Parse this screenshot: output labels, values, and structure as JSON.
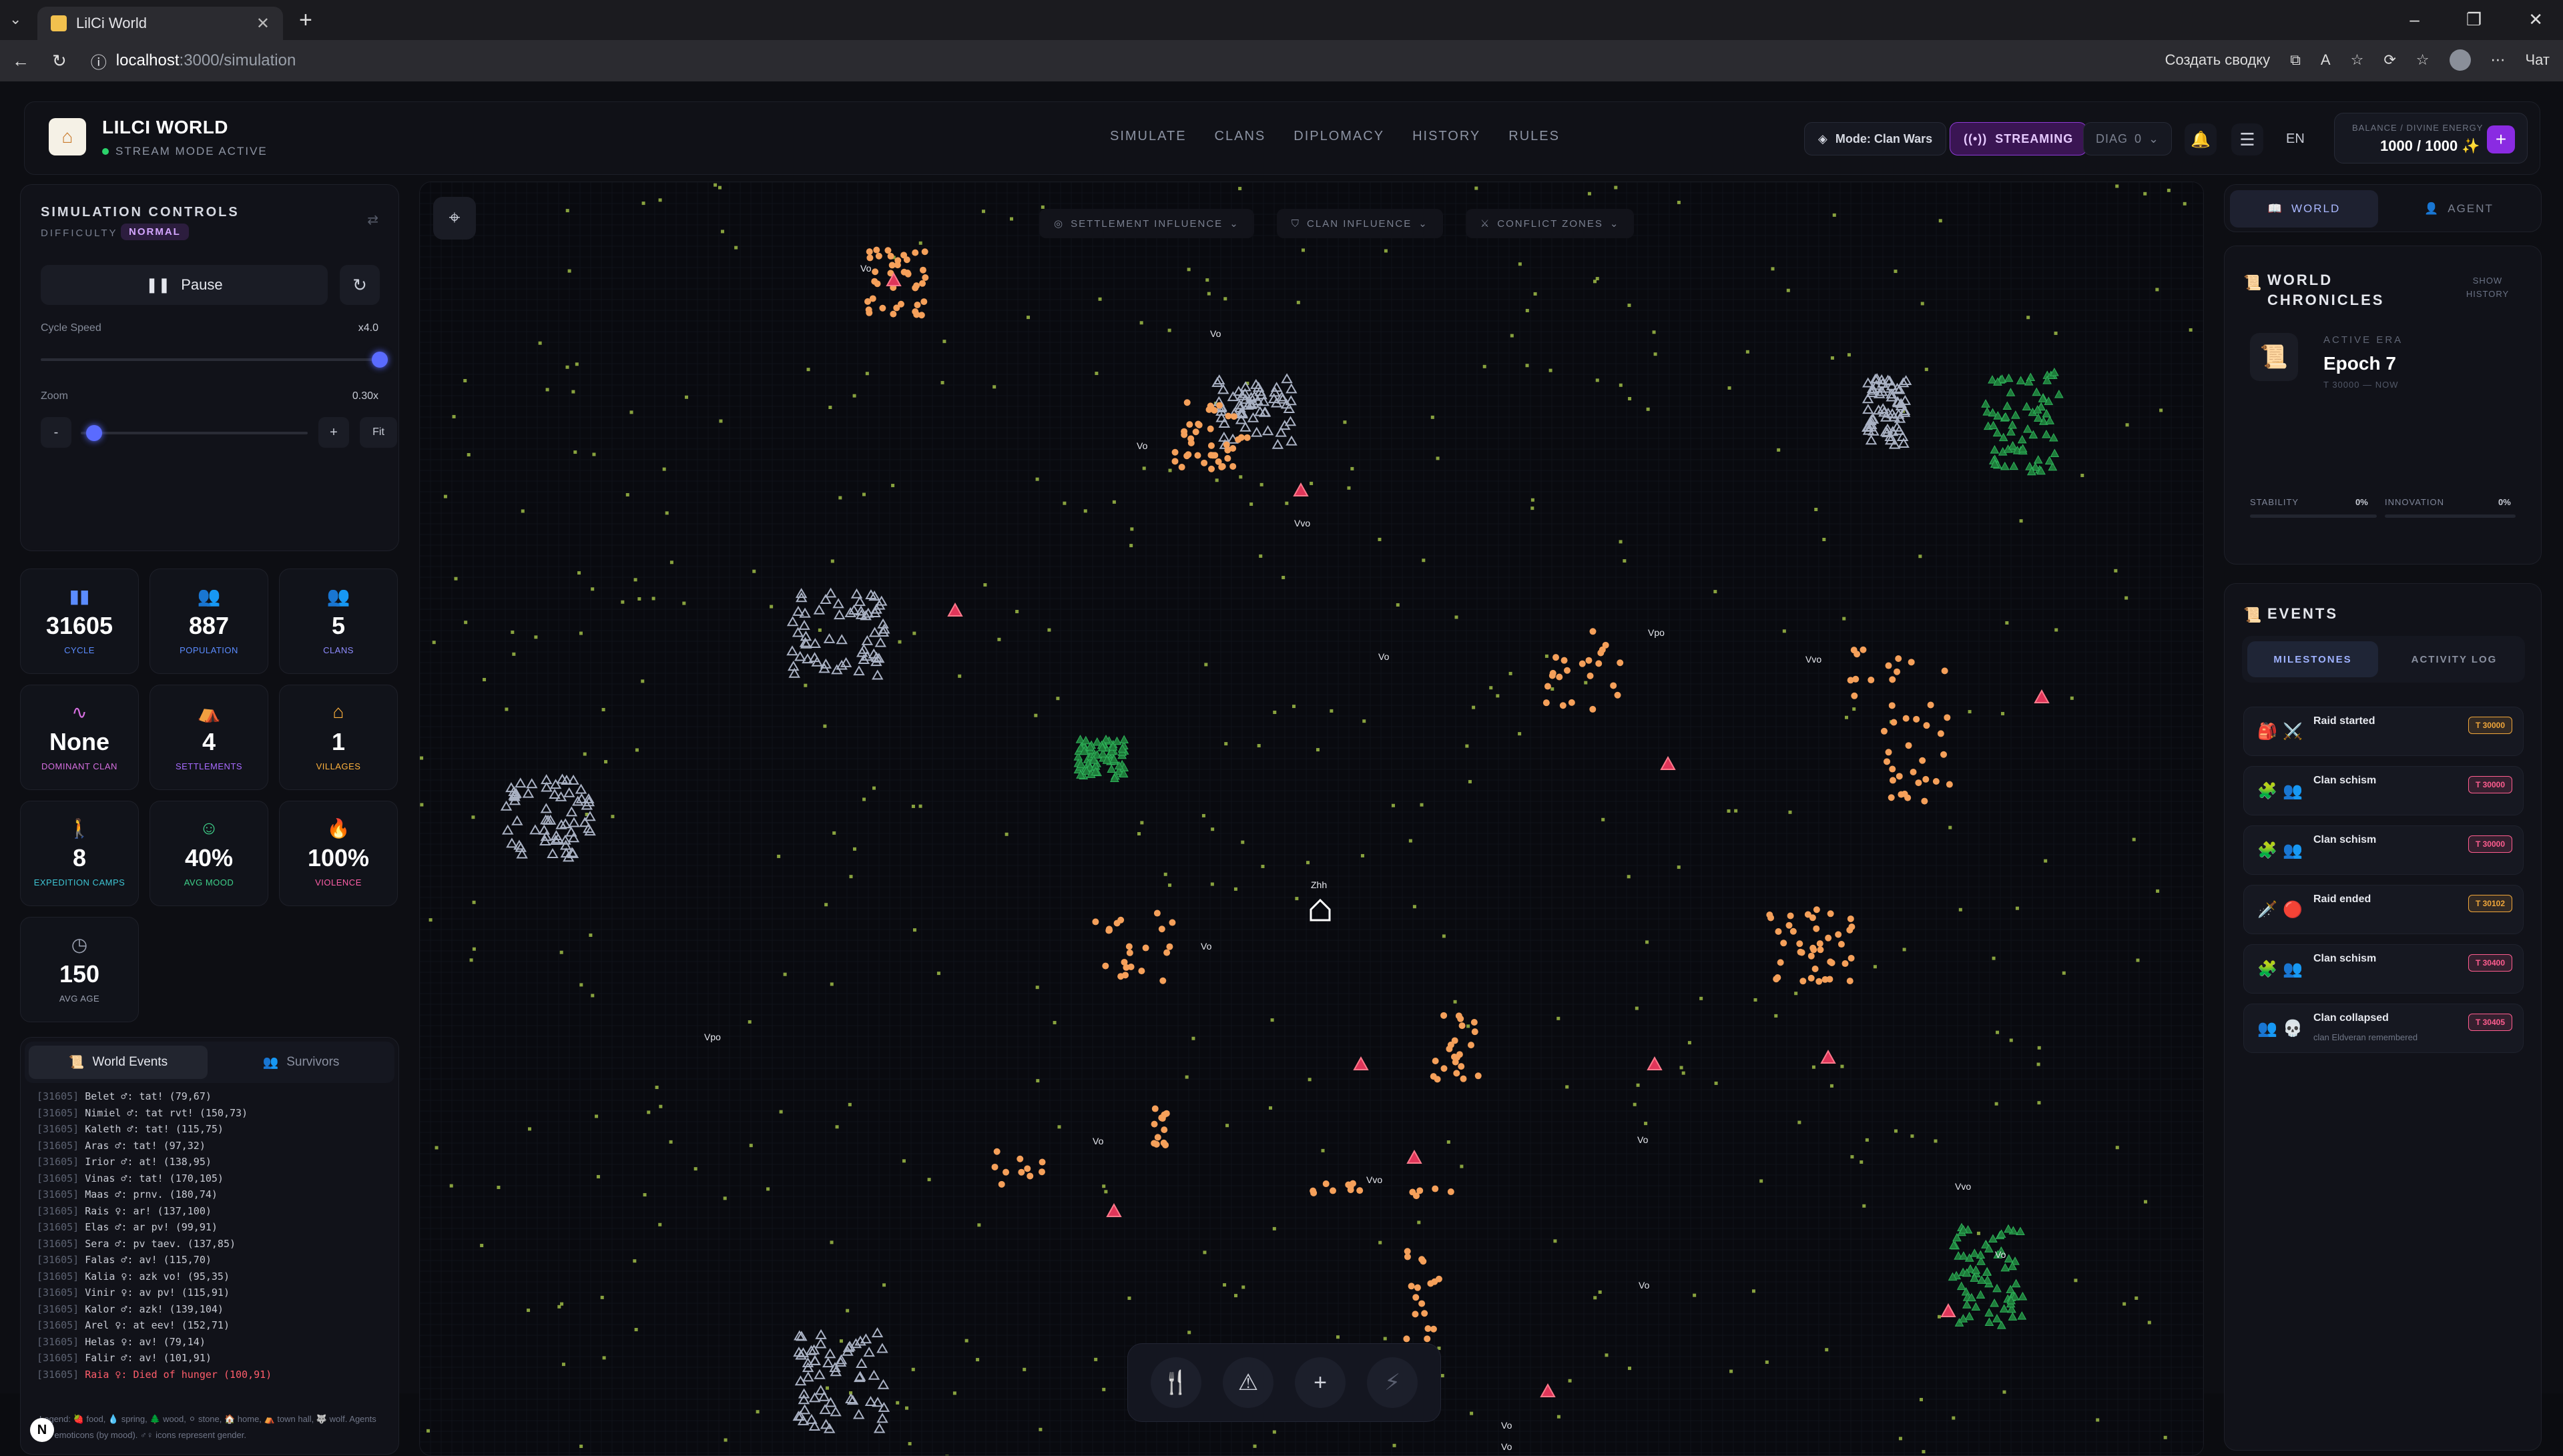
{
  "browser": {
    "tab_title": "LilCi World",
    "url_host": "localhost",
    "url_path": ":3000/simulation",
    "summary_label": "Создать сводку",
    "chat_label": "Чат"
  },
  "header": {
    "brand": "LILCI WORLD",
    "stream_status": "STREAM MODE ACTIVE",
    "nav": [
      "SIMULATE",
      "CLANS",
      "DIPLOMACY",
      "HISTORY",
      "RULES"
    ],
    "mode": "Mode: Clan Wars",
    "streaming": "STREAMING",
    "diag": "DIAG",
    "diag_count": "0",
    "lang": "EN",
    "balance_label": "BALANCE / DIVINE ENERGY",
    "balance_value": "1000 / 1000 ✨"
  },
  "sim": {
    "title": "SIMULATION CONTROLS",
    "difficulty_label": "DIFFICULTY",
    "difficulty_value": "NORMAL",
    "pause_label": "Pause",
    "cycle_speed_label": "Cycle Speed",
    "cycle_speed_value": "x4.0",
    "cycle_speed_level": 1.0,
    "zoom_label": "Zoom",
    "zoom_value": "0.30x",
    "zoom_level": 0.06,
    "zoom_minus": "-",
    "zoom_plus": "+",
    "fit_label": "Fit"
  },
  "stats": [
    {
      "value": "31605",
      "label": "CYCLE",
      "color": "#5b8cff",
      "icon": "bar-chart-icon"
    },
    {
      "value": "887",
      "label": "POPULATION",
      "color": "#5b8cff",
      "icon": "people-icon"
    },
    {
      "value": "5",
      "label": "CLANS",
      "color": "#8f8cff",
      "icon": "group-icon"
    },
    {
      "value": "None",
      "label": "DOMINANT CLAN",
      "color": "#d66fe0",
      "icon": "pulse-icon"
    },
    {
      "value": "4",
      "label": "SETTLEMENTS",
      "color": "#a86bff",
      "icon": "tent-icon"
    },
    {
      "value": "1",
      "label": "VILLAGES",
      "color": "#ffb23d",
      "icon": "house-icon"
    },
    {
      "value": "8",
      "label": "EXPEDITION CAMPS",
      "color": "#3ec5d4",
      "icon": "hiker-icon"
    },
    {
      "value": "40%",
      "label": "AVG MOOD",
      "color": "#3fd18a",
      "icon": "smile-icon"
    },
    {
      "value": "100%",
      "label": "VIOLENCE",
      "color": "#ff5fa8",
      "icon": "flame-icon"
    },
    {
      "value": "150",
      "label": "AVG AGE",
      "color": "#9aa0b0",
      "icon": "clock-icon"
    }
  ],
  "left_tabs": {
    "world_events": "World Events",
    "survivors": "Survivors"
  },
  "log": [
    {
      "stamp": "[31605]",
      "text": "Belet ♂: tat! (79,67)",
      "red": false
    },
    {
      "stamp": "[31605]",
      "text": "Nimiel ♂: tat rvt! (150,73)",
      "red": false
    },
    {
      "stamp": "[31605]",
      "text": "Kaleth ♂: tat! (115,75)",
      "red": false
    },
    {
      "stamp": "[31605]",
      "text": "Aras ♂: tat! (97,32)",
      "red": false
    },
    {
      "stamp": "[31605]",
      "text": "Irior ♂: at! (138,95)",
      "red": false
    },
    {
      "stamp": "[31605]",
      "text": "Vinas ♂: tat! (170,105)",
      "red": false
    },
    {
      "stamp": "[31605]",
      "text": "Maas ♂: prnv. (180,74)",
      "red": false
    },
    {
      "stamp": "[31605]",
      "text": "Rais ♀: ar! (137,100)",
      "red": false
    },
    {
      "stamp": "[31605]",
      "text": "Elas ♂: ar pv! (99,91)",
      "red": false
    },
    {
      "stamp": "[31605]",
      "text": "Sera ♂: pv taev. (137,85)",
      "red": false
    },
    {
      "stamp": "[31605]",
      "text": "Falas ♂: av! (115,70)",
      "red": false
    },
    {
      "stamp": "[31605]",
      "text": "Kalia ♀: azk vo! (95,35)",
      "red": false
    },
    {
      "stamp": "[31605]",
      "text": "Vinir ♀: av pv! (115,91)",
      "red": false
    },
    {
      "stamp": "[31605]",
      "text": "Kalor ♂: azk! (139,104)",
      "red": false
    },
    {
      "stamp": "[31605]",
      "text": "Arel ♀: at eev! (152,71)",
      "red": false
    },
    {
      "stamp": "[31605]",
      "text": "Helas ♀: av! (79,14)",
      "red": false
    },
    {
      "stamp": "[31605]",
      "text": "Falir ♂: av! (101,91)",
      "red": false
    },
    {
      "stamp": "[31605]",
      "text": "Raia ♀: Died of hunger (100,91)",
      "red": true
    }
  ],
  "legend": "Legend: 🍓 food, 💧 spring, 🌲 wood, ⚪ stone, 🏠 home, ⛺ town hall, 🐺 wolf. Agents are emoticons (by mood). ♂♀ icons represent gender.",
  "map": {
    "chips": [
      "SETTLEMENT INFLUENCE",
      "CLAN INFLUENCE",
      "CONFLICT ZONES"
    ],
    "labels": [
      {
        "t": "Vo"
      },
      {
        "t": "Vo"
      },
      {
        "t": "Vo"
      },
      {
        "t": "Vvo"
      },
      {
        "t": "Vo"
      },
      {
        "t": "Vpo"
      },
      {
        "t": "Vvo"
      },
      {
        "t": "Zhh"
      },
      {
        "t": "Vpo"
      },
      {
        "t": "Vo"
      },
      {
        "t": "Vo"
      },
      {
        "t": "Vo"
      },
      {
        "t": "Vo"
      },
      {
        "t": "Vvo"
      },
      {
        "t": "Vo"
      },
      {
        "t": "Vo"
      },
      {
        "t": "Vvo"
      },
      {
        "t": "Vo"
      }
    ]
  },
  "right_tabs": {
    "world": "WORLD",
    "agent": "AGENT"
  },
  "chronicles": {
    "title": "WORLD CHRONICLES",
    "show_history": "SHOW HISTORY",
    "active_era_label": "ACTIVE ERA",
    "epoch": "Epoch 7",
    "range": "T 30000 — NOW",
    "stability_label": "STABILITY",
    "stability_value": "0%",
    "innovation_label": "INNOVATION",
    "innovation_value": "0%"
  },
  "events": {
    "title": "EVENTS",
    "tab_milestones": "MILESTONES",
    "tab_activity": "ACTIVITY LOG",
    "items": [
      {
        "title": "Raid started",
        "sub": "",
        "tick": "T 30000",
        "tick_color": "#f0a63a",
        "i1": "🎒",
        "i2": "⚔️"
      },
      {
        "title": "Clan schism",
        "sub": "",
        "tick": "T 30000",
        "tick_color": "#ff5d8f",
        "i1": "🧩",
        "i2": "👥"
      },
      {
        "title": "Clan schism",
        "sub": "",
        "tick": "T 30000",
        "tick_color": "#ff5d8f",
        "i1": "🧩",
        "i2": "👥"
      },
      {
        "title": "Raid ended",
        "sub": "",
        "tick": "T 30102",
        "tick_color": "#f0a63a",
        "i1": "🗡️",
        "i2": "🔴"
      },
      {
        "title": "Clan schism",
        "sub": "",
        "tick": "T 30400",
        "tick_color": "#ff5d8f",
        "i1": "🧩",
        "i2": "👥"
      },
      {
        "title": "Clan collapsed",
        "sub": "clan Eldveran remembered",
        "tick": "T 30405",
        "tick_color": "#ff5d8f",
        "i1": "👥",
        "i2": "💀"
      }
    ]
  },
  "dock": {
    "tools": [
      "fork-knife-icon",
      "warning-icon",
      "plus-icon",
      "lightning-icon"
    ]
  }
}
